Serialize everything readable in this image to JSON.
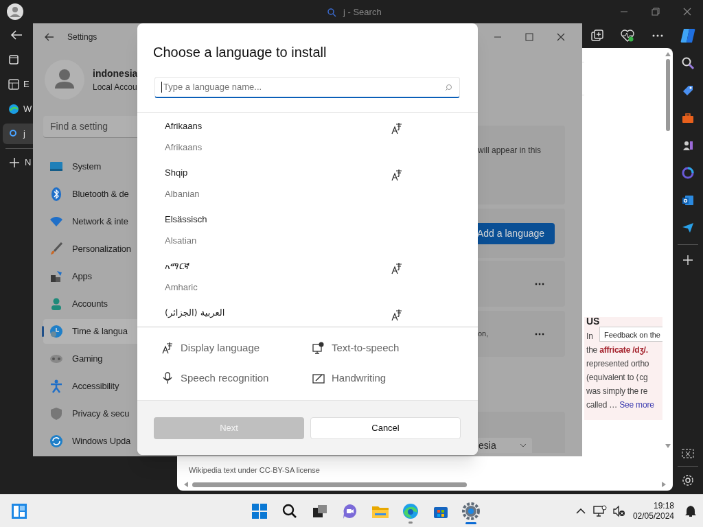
{
  "browser": {
    "search_title": "j - Search",
    "tabs": [
      {
        "label": "E",
        "selected": false
      },
      {
        "label": "W",
        "selected": false
      },
      {
        "label": "j",
        "selected": true
      }
    ],
    "new_tab": "N",
    "article": {
      "heading": "US",
      "tooltip": "Feedback on the",
      "lines": [
        "In",
        "the **affricate /dʒ/.**",
        "represented ortho",
        "(equivalent to ⟨cg",
        "was simply the re",
        "called …"
      ],
      "link": "See more"
    },
    "footer": "Wikipedia text under CC-BY-SA license"
  },
  "settings": {
    "title": "Settings",
    "user": "indonesia",
    "account": "Local Accou",
    "search_placeholder": "Find a setting",
    "nav": [
      {
        "label": "System",
        "selected": false
      },
      {
        "label": "Bluetooth & de",
        "selected": false
      },
      {
        "label": "Network & inte",
        "selected": false
      },
      {
        "label": "Personalization",
        "selected": false
      },
      {
        "label": "Apps",
        "selected": false
      },
      {
        "label": "Accounts",
        "selected": false
      },
      {
        "label": "Time & langua",
        "selected": true
      },
      {
        "label": "Gaming",
        "selected": false
      },
      {
        "label": "Accessibility",
        "selected": false
      },
      {
        "label": "Privacy & secu",
        "selected": false
      },
      {
        "label": "Windows Upda",
        "selected": false
      }
    ],
    "card_text": "will appear in this",
    "add_button": "Add a language",
    "card_text_2": "on,",
    "dropdown_value": "esia"
  },
  "dialog": {
    "title": "Choose a language to install",
    "placeholder": "Type a language name...",
    "languages": [
      {
        "name": "Afrikaans",
        "english": "Afrikaans",
        "display": true
      },
      {
        "name": "Shqip",
        "english": "Albanian",
        "display": true
      },
      {
        "name": "Elsässisch",
        "english": "Alsatian",
        "display": false
      },
      {
        "name": "አማርኛ",
        "english": "Amharic",
        "display": true
      },
      {
        "name": "العربية (الجزائر)",
        "display": true
      }
    ],
    "features": [
      {
        "kind": "display",
        "label": "Display language"
      },
      {
        "kind": "tts",
        "label": "Text-to-speech"
      },
      {
        "kind": "speech",
        "label": "Speech recognition"
      },
      {
        "kind": "handwriting",
        "label": "Handwriting"
      }
    ],
    "buttons": [
      {
        "label": "Next",
        "disabled": true
      },
      {
        "label": "Cancel",
        "disabled": false
      }
    ]
  },
  "taskbar": {
    "time": "19:18",
    "date": "02/05/2024"
  }
}
